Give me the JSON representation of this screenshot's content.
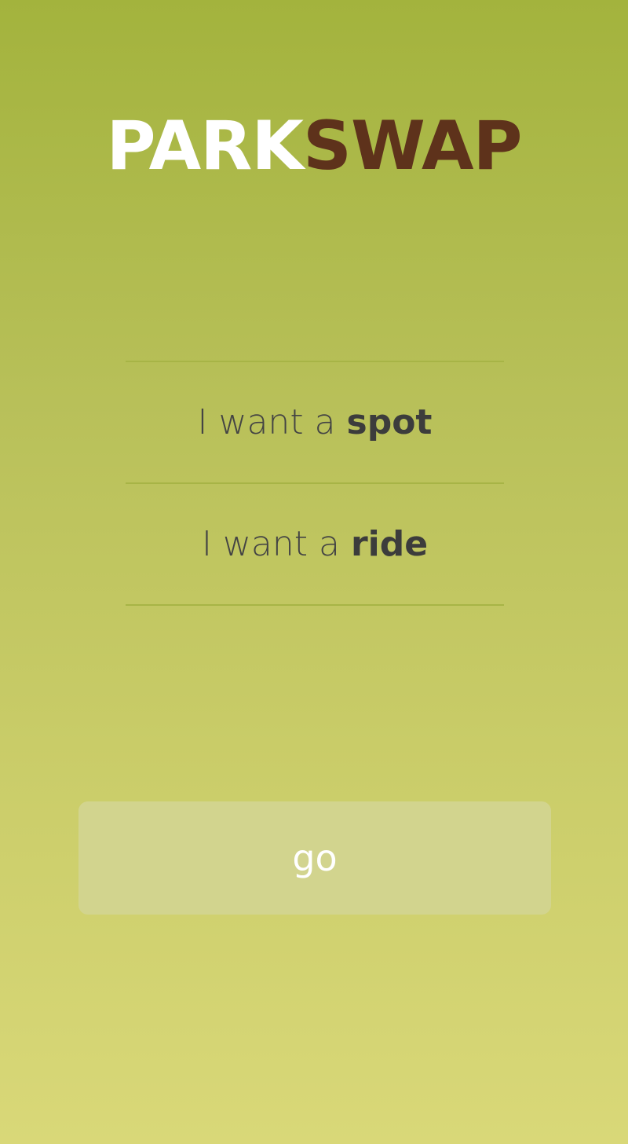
{
  "logo": {
    "part1": "PARK",
    "part2": "SWAP",
    "colors": {
      "part1": "#ffffff",
      "part2": "#5e321b"
    }
  },
  "options": [
    {
      "prefix": "I want a ",
      "keyword": "spot"
    },
    {
      "prefix": "I want a ",
      "keyword": "ride"
    }
  ],
  "go_button": {
    "label": "go"
  },
  "colors": {
    "background_top": "#a3b33d",
    "background_bottom": "#d9d878",
    "divider": "#a7b446",
    "button_bg": "#d2d48e",
    "text": "#3f3f3f"
  }
}
